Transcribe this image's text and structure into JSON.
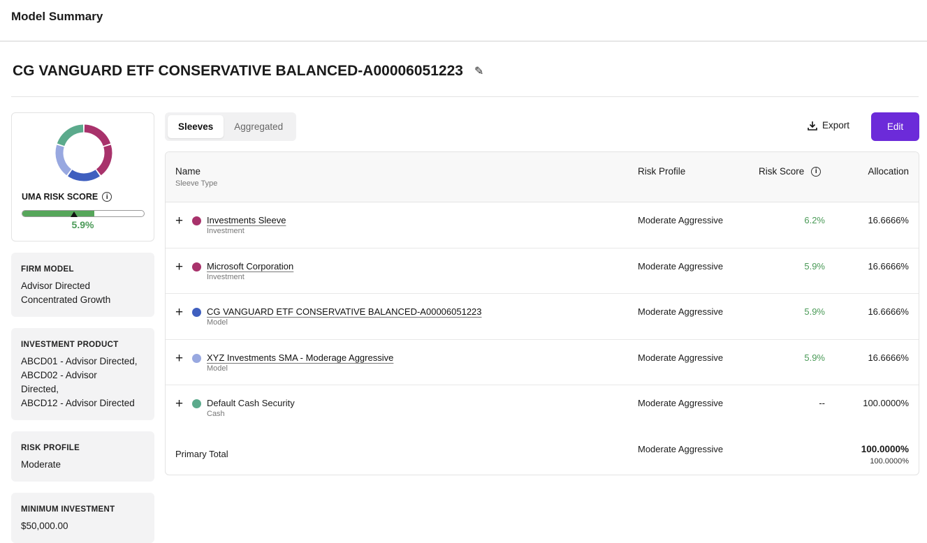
{
  "header": {
    "title": "Model Summary"
  },
  "model": {
    "title": "CG VANGUARD ETF CONSERVATIVE BALANCED-A00006051223"
  },
  "risk_card": {
    "label": "UMA RISK SCORE",
    "value": "5.9%",
    "bar_fill_percent": 59,
    "donut_colors": [
      "#a8326b",
      "#a8326b",
      "#3f5fbf",
      "#98a8e0",
      "#5baa8c"
    ]
  },
  "info_cards": [
    {
      "label": "FIRM MODEL",
      "lines": [
        "Advisor Directed",
        "Concentrated Growth"
      ]
    },
    {
      "label": "INVESTMENT PRODUCT",
      "lines": [
        "ABCD01 - Advisor Directed,",
        "ABCD02 - Advisor",
        "Directed,",
        "ABCD12 - Advisor Directed"
      ]
    },
    {
      "label": "RISK PROFILE",
      "lines": [
        "Moderate"
      ]
    },
    {
      "label": "MINIMUM INVESTMENT",
      "lines": [
        "$50,000.00"
      ]
    }
  ],
  "tabs": [
    {
      "label": "Sleeves"
    },
    {
      "label": "Aggregated"
    }
  ],
  "toolbar": {
    "export": "Export",
    "edit": "Edit"
  },
  "table": {
    "headers": {
      "name": "Name",
      "name_sub": "Sleeve Type",
      "risk_profile": "Risk Profile",
      "risk_score": "Risk Score",
      "allocation": "Allocation"
    },
    "rows": [
      {
        "name": "Investments Sleeve",
        "type": "Investment",
        "color": "#a8326b",
        "risk_profile": "Moderate Aggressive",
        "risk_score": "6.2%",
        "allocation": "16.6666%",
        "link": true
      },
      {
        "name": "Microsoft Corporation",
        "type": "Investment",
        "color": "#a8326b",
        "risk_profile": "Moderate Aggressive",
        "risk_score": "5.9%",
        "allocation": "16.6666%",
        "link": true
      },
      {
        "name": "CG VANGUARD ETF CONSERVATIVE BALANCED-A00006051223",
        "type": "Model",
        "color": "#3f5fbf",
        "risk_profile": "Moderate Aggressive",
        "risk_score": "5.9%",
        "allocation": "16.6666%",
        "link": true
      },
      {
        "name": "XYZ Investments SMA - Moderage Aggressive",
        "type": "Model",
        "color": "#98a8e0",
        "risk_profile": "Moderate Aggressive",
        "risk_score": "5.9%",
        "allocation": "16.6666%",
        "link": true
      },
      {
        "name": "Default Cash Security",
        "type": "Cash",
        "color": "#5baa8c",
        "risk_profile": "Moderate Aggressive",
        "risk_score": "--",
        "allocation": "100.0000%",
        "link": false
      }
    ],
    "total": {
      "label": "Primary Total",
      "risk_profile": "Moderate Aggressive",
      "allocation": "100.0000%",
      "allocation_sub": "100.0000%"
    }
  }
}
